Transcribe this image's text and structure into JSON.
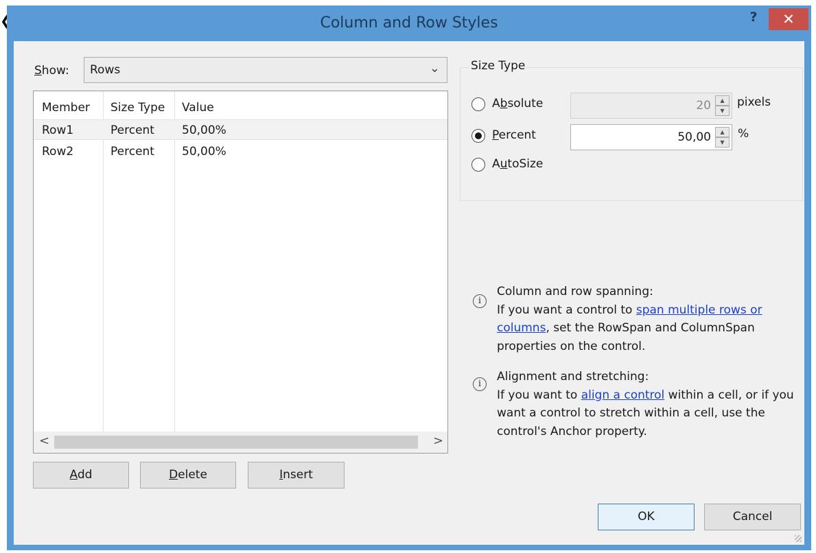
{
  "dialog": {
    "title": "Column and Row Styles",
    "help_label": "?",
    "close_label": "✕"
  },
  "show": {
    "label": "Show:",
    "value": "Rows"
  },
  "grid": {
    "columns": [
      "Member",
      "Size Type",
      "Value"
    ],
    "rows": [
      {
        "member": "Row1",
        "size_type": "Percent",
        "value": "50,00%"
      },
      {
        "member": "Row2",
        "size_type": "Percent",
        "value": "50,00%"
      }
    ],
    "scroll_left": "<",
    "scroll_right": ">"
  },
  "buttons": {
    "add": "Add",
    "delete": "Delete",
    "insert": "Insert",
    "ok": "OK",
    "cancel": "Cancel"
  },
  "size_type": {
    "title": "Size Type",
    "absolute_label": "Absolute",
    "absolute_value": "20",
    "absolute_unit": "pixels",
    "percent_label": "Percent",
    "percent_value": "50,00",
    "percent_unit": "%",
    "autosize_label": "AutoSize",
    "selected": "percent"
  },
  "info": {
    "spanning_title": "Column and row spanning:",
    "spanning_pre": "If you want a control to ",
    "spanning_link": "span multiple rows or columns",
    "spanning_post": ", set the RowSpan and ColumnSpan properties on the control.",
    "align_title": "Alignment and stretching:",
    "align_pre": "If you want to ",
    "align_link": "align a control",
    "align_post": " within a cell, or if you want a control to stretch within a cell, use the control's Anchor property."
  },
  "colors": {
    "titlebar": "#5b9bd5",
    "close": "#c7504b",
    "link": "#1a3fcf"
  }
}
